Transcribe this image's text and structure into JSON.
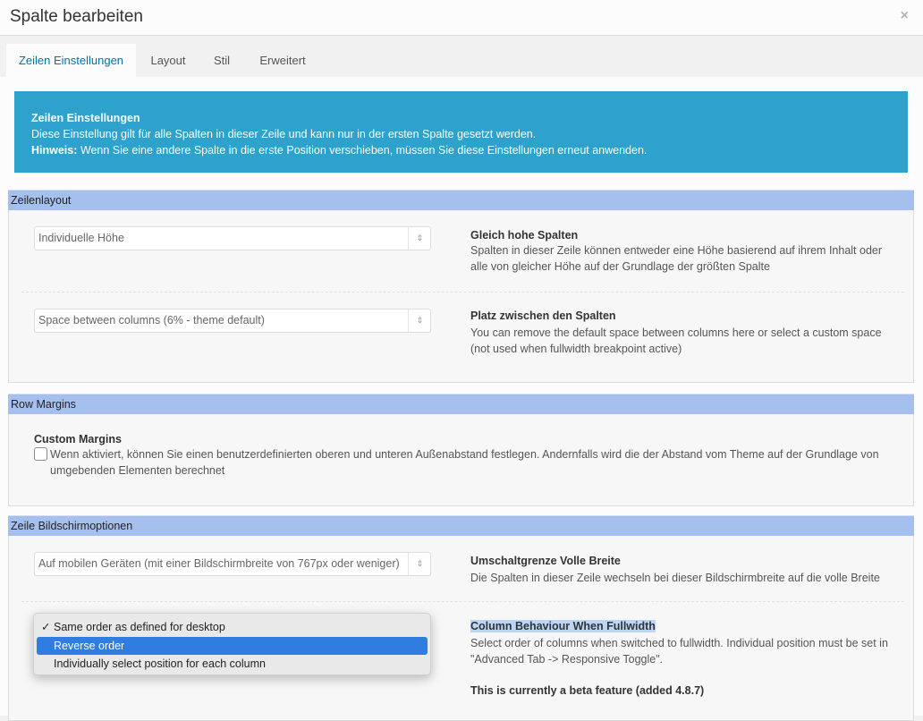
{
  "dialog": {
    "title": "Spalte bearbeiten",
    "close_icon": "×"
  },
  "tabs": [
    {
      "label": "Zeilen Einstellungen",
      "active": true
    },
    {
      "label": "Layout"
    },
    {
      "label": "Stil"
    },
    {
      "label": "Erweitert"
    }
  ],
  "notice": {
    "title": "Zeilen Einstellungen",
    "text": "Diese Einstellung gilt für alle Spalten in dieser Zeile und kann nur in der ersten Spalte gesetzt werden.",
    "hint_label": "Hinweis:",
    "hint_text": " Wenn Sie eine andere Spalte in die erste Position verschieben, müssen Sie diese Einstellungen erneut anwenden."
  },
  "sections": {
    "zeilenlayout": {
      "title": "Zeilenlayout",
      "equal_height": {
        "value": "Individuelle Höhe",
        "title": "Gleich hohe Spalten",
        "desc": "Spalten in dieser Zeile können entweder eine Höhe basierend auf ihrem Inhalt oder alle von gleicher Höhe auf der Grundlage der größten Spalte"
      },
      "space": {
        "value": "Space between columns (6% - theme default)",
        "title": "Platz zwischen den Spalten",
        "desc": "You can remove the default space between columns here or select a custom space (not used when fullwidth breakpoint active)"
      }
    },
    "row_margins": {
      "title": "Row Margins",
      "custom_title": "Custom Margins",
      "custom_desc": "Wenn aktiviert, können Sie einen benutzerdefinierten oberen und unteren Außenabstand festlegen. Andernfalls wird die der Abstand vom Theme auf der Grundlage von umgebenden Elementen berechnet",
      "checked": false
    },
    "screen_options": {
      "title": "Zeile Bildschirmoptionen",
      "breakpoint": {
        "value": "Auf mobilen Geräten (mit einer Bildschirmbreite von 767px oder weniger)",
        "title": "Umschaltgrenze Volle Breite",
        "desc": "Die Spalten in dieser Zeile wechseln bei dieser Bildschirmbreite auf die volle Breite"
      },
      "behaviour": {
        "title": "Column Behaviour When Fullwidth",
        "desc": "Select order of columns when switched to fullwidth. Individual position must be set in \"Advanced Tab -> Responsive Toggle\".",
        "beta": "This is currently a beta feature (added 4.8.7)",
        "options": [
          {
            "label": "Same order as defined for desktop",
            "checked": true
          },
          {
            "label": "Reverse order",
            "highlighted": true
          },
          {
            "label": "Individually select position for each column"
          }
        ]
      }
    }
  },
  "icons": {
    "select_arrows": "⇕",
    "checkmark": "✓"
  }
}
